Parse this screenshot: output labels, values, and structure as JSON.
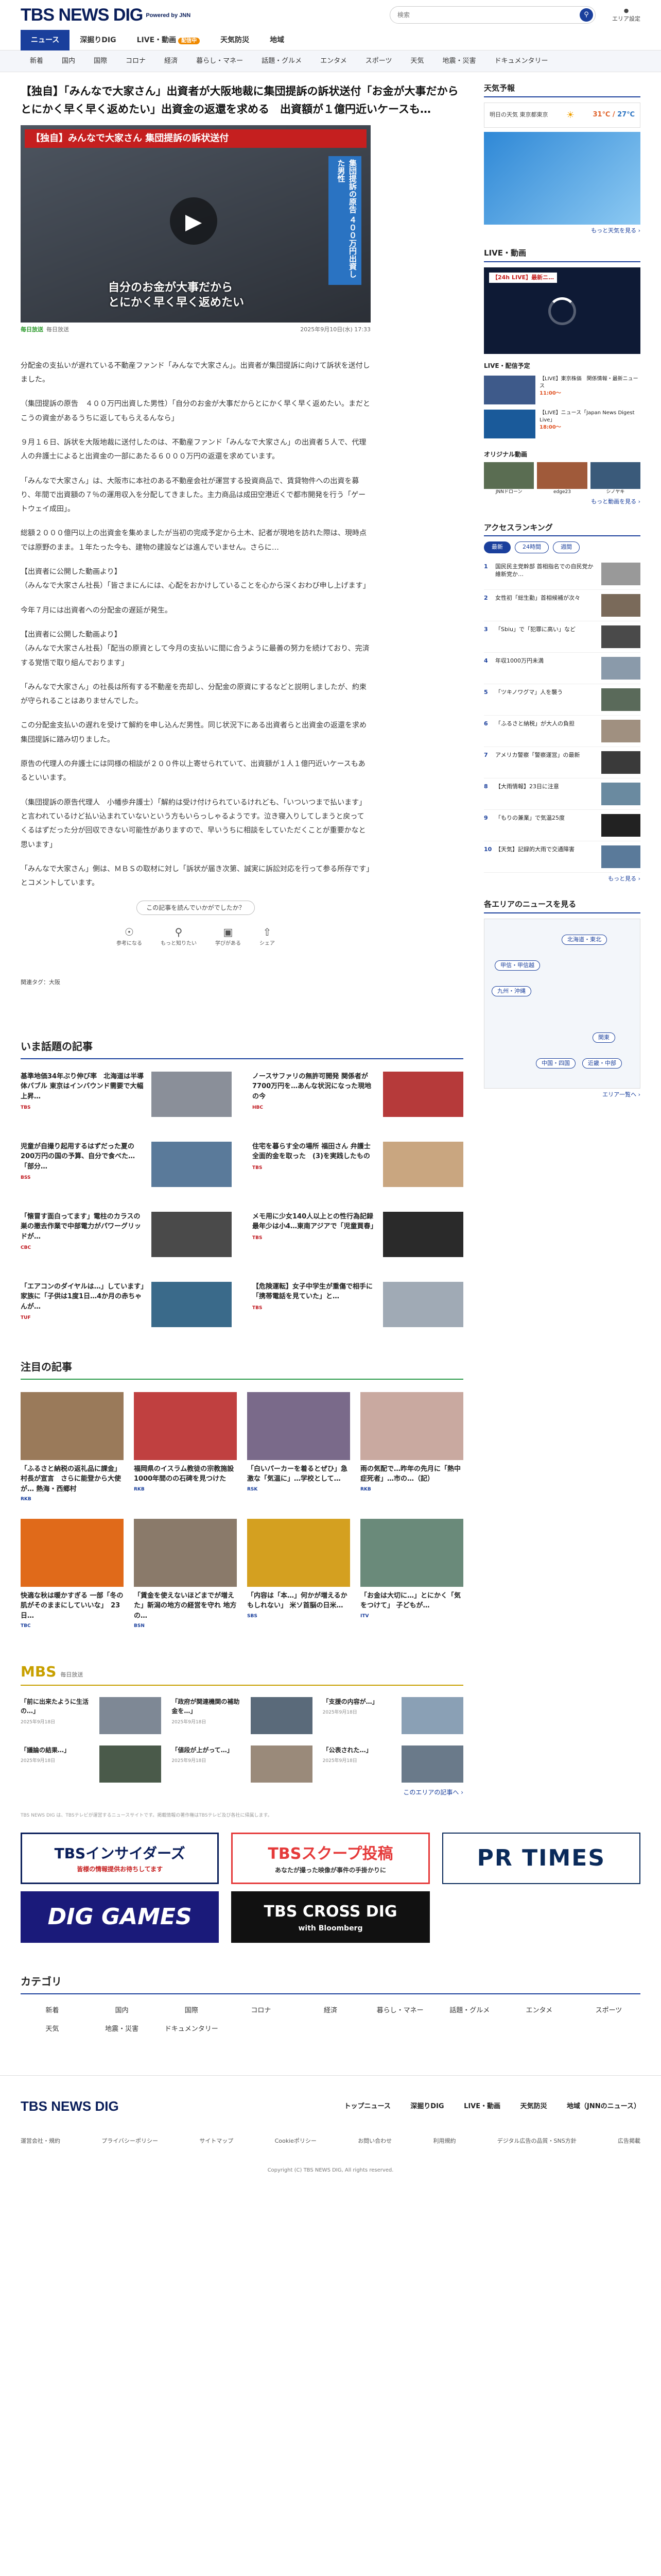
{
  "header": {
    "logo": "TBS NEWS DIG",
    "powered": "Powered by JNN",
    "search_placeholder": "検索",
    "search_icon": "search-icon",
    "area_label": "エリア設定"
  },
  "nav_main": [
    {
      "label": "ニュース",
      "active": true
    },
    {
      "label": "深掘りDIG",
      "active": false
    },
    {
      "label": "LIVE・動画",
      "active": false,
      "badge": "配信中"
    },
    {
      "label": "天気防災",
      "active": false
    },
    {
      "label": "地域",
      "active": false
    }
  ],
  "nav_sub": [
    "新着",
    "国内",
    "国際",
    "コロナ",
    "経済",
    "暮らし・マネー",
    "話題・グルメ",
    "エンタメ",
    "スポーツ",
    "天気",
    "地震・災害",
    "ドキュメンタリー"
  ],
  "article": {
    "title": "【独自】「みんなで大家さん」出資者が大阪地裁に集団提訴の訴状送付「お金が大事だからとにかく早く早く返めたい」出資金の返還を求める　出資額が１億円近いケースも…",
    "video_banner": "【独自】みんなで大家さん 集団提訴の訴状送付",
    "video_caption": "自分のお金が大事だから\nとにかく早く早く返めたい",
    "video_side": "集団提訴の原告\n４００万円出資した男性",
    "source_brand": "毎日放送",
    "source_name": "毎日放送",
    "date": "2025年9月10日(水) 17:33",
    "paragraphs": [
      "分配金の支払いが遅れている不動産ファンド「みんなで大家さん」。出資者が集団提訴に向けて訴状を送付しました。",
      "（集団提訴の原告　４００万円出資した男性）「自分のお金が大事だからとにかく早く早く返めたい。まだとこうの資金があるうちに返してもらえるんなら」",
      "９月１６日、訴状を大阪地裁に送付したのは、不動産ファンド「みんなで大家さん」の出資者５人で、代理人の弁護士によると出資金の一部にあたる６０００万円の返還を求めています。",
      "「みんなで大家さん」は、大阪市に本社のある不動産会社が運営する投資商品で、賃貸物件への出資を募り、年間で出資額の７％の運用収入を分配してきました。主力商品は成田空港近くで都市開発を行う「ゲートウェイ成田」。",
      "総額２０００億円以上の出資金を集めましたが当初の完成予定から土木、記者が現地を訪れた際は、現時点では原野のまま。１年たった今も、建物の建設などは進んでいません。さらに…",
      "【出資者に公開した動画より】\n（みんなで大家さん社長）「皆さまにんには、心配をおかけしていることを心から深くおわび申し上げます」",
      "今年７月には出資者への分配金の遅延が発生。",
      "【出資者に公開した動画より】\n（みんなで大家さん社長）「配当の原資として今月の支払いに間に合うように最善の努力を続けており、完済する覚悟で取り組んでおります」",
      "「みんなで大家さん」の社長は所有する不動産を売却し、分配金の原資にするなどと説明しましたが、約束が守られることはありませんでした。",
      "この分配金支払いの遅れを受けて解約を申し込んだ男性。同じ状況下にある出資者らと出資金の返還を求め集団提訴に踏み切りました。",
      "原告の代理人の弁護士には同様の相談が２００件以上寄せられていて、出資額が１人１億円近いケースもあるといいます。",
      "（集団提訴の原告代理人　小幡歩弁護士）「解約は受け付けられているけれども、「いついつまで払います」と言われているけど払い込まれていないという方もいらっしゃるようです。泣き寝入りしてしまうと戻ってくるはずだった分が回収できない可能性がありますので、早いうちに相談をしていただくことが重要かなと思います」",
      "「みんなで大家さん」側は、ＭＢＳの取材に対し「訴状が届き次第、誠実に訴訟対応を行って参る所存です」とコメントしています。"
    ],
    "feedback_label": "この記事を読んでいかがでしたか？",
    "reactions": [
      {
        "icon": "bulb-icon",
        "label": "参考になる"
      },
      {
        "icon": "search-icon",
        "label": "もっと知りたい"
      },
      {
        "icon": "book-icon",
        "label": "学びがある"
      },
      {
        "icon": "share-icon",
        "label": "シェア"
      }
    ],
    "tag": "関連タグ：大阪"
  },
  "trending": {
    "title": "いま話題の記事",
    "items": [
      {
        "text": "基準地価34年ぶり伸び率　北海道は半導体バブル 東京はインバウンド需要で大幅上昇…",
        "src": "TBS"
      },
      {
        "text": "ノースサファリの無許可開発 関係者が7700万円を…あんな状況になった現地の今",
        "src": "HBC"
      },
      {
        "text": "児童が自撮り起用するはずだった夏の200万円の国の予算、自分で食べた…「部分…",
        "src": "BSS"
      },
      {
        "text": "住宅を暮らす全の場所 福田さん 弁護士全面的金を取った　(3)を実践したもの",
        "src": "TBS"
      },
      {
        "text": "「懐冒す面白ってます」電柱のカラスの巣の撤去作業で中部電力がパワーグリッドが…",
        "src": "CBC"
      },
      {
        "text": "メモ用に少女140人以上との性行為記録 最年少は小4…東南アジアで「児童買春」",
        "src": "TBS"
      },
      {
        "text": "「エアコンのダイヤルは…」しています」家族に「子供は1度1日…4か月の赤ちゃんが…",
        "src": "TUF"
      },
      {
        "text": "【危険運転】女子中学生が重傷で相手に「携帯電話を見ていた」と…",
        "src": "TBS"
      }
    ]
  },
  "featured": {
    "title": "注目の記事",
    "items": [
      {
        "text": "「ふるさと納税の返礼品に課金」村長が宣言　さらに能登から大使が… 熱海・西郷村",
        "src": "RKB"
      },
      {
        "text": "福岡県のイスラム教徒の宗教施設 1000年間のの石碑を見つけた",
        "src": "RKB"
      },
      {
        "text": "「白いパーカーを着るとぜひ」急激な「気温に」…学校として…",
        "src": "RSK"
      },
      {
        "text": "雨の気配で…昨年の先月に「熱中症死者」…市の…（記）",
        "src": "RKB"
      },
      {
        "text": "快適な秋は暖かすぎる 一部「冬の肌がそのままにしていいな」　23日…",
        "src": "TBC"
      },
      {
        "text": "「賃金を使えないほどまでが増えた」新潟の地方の経営を守れ 地方の…",
        "src": "BSN"
      },
      {
        "text": "「内容は「本…」何かが増えるかもしれない」 米ソ首脳の日米…",
        "src": "SBS"
      },
      {
        "text": "「お金は大切に…」とにかく「気をつけて」 子どもが…",
        "src": "ITV"
      }
    ]
  },
  "mbs": {
    "logo": "MBS",
    "subtitle": "毎日放送",
    "items": [
      {
        "text": "「前に出来たように生活の…」",
        "date": "2025年9月18日"
      },
      {
        "text": "「政府が関連機関の補助金を…」",
        "date": "2025年9月18日"
      },
      {
        "text": "「支援の内容が…」",
        "date": "2025年9月18日"
      },
      {
        "text": "「議論の結果…」",
        "date": "2025年9月18日"
      },
      {
        "text": "「値段が上がって…」",
        "date": "2025年9月18日"
      },
      {
        "text": "「公表された…」",
        "date": "2025年9月18日"
      }
    ],
    "more": "このエリアの記事へ ›"
  },
  "disclaimer": "TBS NEWS DIG は、TBSテレビが運営するニュースサイトです。掲載情報の著作権はTBSテレビ及び各社に帰属します。",
  "banners": [
    {
      "title": "TBSインサイダーズ",
      "sub": "皆様の情報提供お待ちしてます"
    },
    {
      "title": "TBSスクープ投稿",
      "sub": "あなたが撮った映像が事件の手掛かりに"
    },
    {
      "title": "PR TIMES",
      "sub": ""
    },
    {
      "title": "DIG GAMES",
      "sub": ""
    },
    {
      "title": "TBS CROSS DIG",
      "sub": "with Bloomberg"
    }
  ],
  "categories": {
    "title": "カテゴリ",
    "items": [
      "新着",
      "国内",
      "国際",
      "コロナ",
      "経済",
      "暮らし・マネー",
      "話題・グルメ",
      "エンタメ",
      "スポーツ",
      "天気",
      "地震・災害",
      "ドキュメンタリー"
    ]
  },
  "footer": {
    "logo": "TBS NEWS DIG",
    "links": [
      "トップニュース",
      "深掘りDIG",
      "LIVE・動画",
      "天気防災",
      "地域（JNNのニュース）"
    ],
    "links2": [
      "運営会社・規約",
      "プライバシーポリシー",
      "サイトマップ",
      "Cookieポリシー",
      "お問い合わせ",
      "利用規約",
      "デジタル広告の品質・SNS方針",
      "広告掲載"
    ],
    "copyright": "Copyright (C) TBS NEWS DIG, All rights reserved."
  },
  "sidebar": {
    "weather_title": "天気予報",
    "weather_place": "明日の天気 東京都東京",
    "weather_temp": "31℃",
    "weather_low": "27℃",
    "weather_more": "もっと天気を見る ›",
    "live_title": "LIVE・動画",
    "live_label": "【24h LIVE】最新ニ…",
    "live_tag": "LIVE",
    "live_schedule": "LIVE・配信予定",
    "live_items": [
      {
        "text": "【LIVE】東京株価　関係情報・最新ニュース",
        "time": "11:00〜"
      },
      {
        "text": "【LIVE】ニュース「Japan News Digest Live」",
        "time": "18:00〜"
      }
    ],
    "orig_title": "オリジナル動画",
    "orig_items": [
      "JNNドローン",
      "edge23",
      "シノヤキ"
    ],
    "orig_more": "もっと動画を見る ›",
    "rank_title": "アクセスランキング",
    "rank_tabs": [
      "最新",
      "24時間",
      "週間"
    ],
    "rank_items": [
      "国民民主党幹部 首相指名での自民党か維新党か…",
      "女性初「総生勤」首相候補が次々",
      "「Sbiu」で「犯罪に高い」など",
      "年収1000万円未満",
      "「ツキノワグマ」人を襲う",
      "「ふるさと納税」が大人の負担",
      "アメリカ警察「警察運営」の最新",
      "【大雨情報】23日に注意",
      "「もりの兼業」で気温25度",
      "【天気】記録的大雨で交通障害"
    ],
    "rank_more": "もっと見る ›",
    "area_title": "各エリアのニュースを見る",
    "areas": [
      "北海道・東北",
      "甲信・甲信越",
      "九州・沖縄",
      "関東",
      "中国・四国",
      "近畿・中部"
    ],
    "area_more": "エリア一覧へ ›"
  }
}
